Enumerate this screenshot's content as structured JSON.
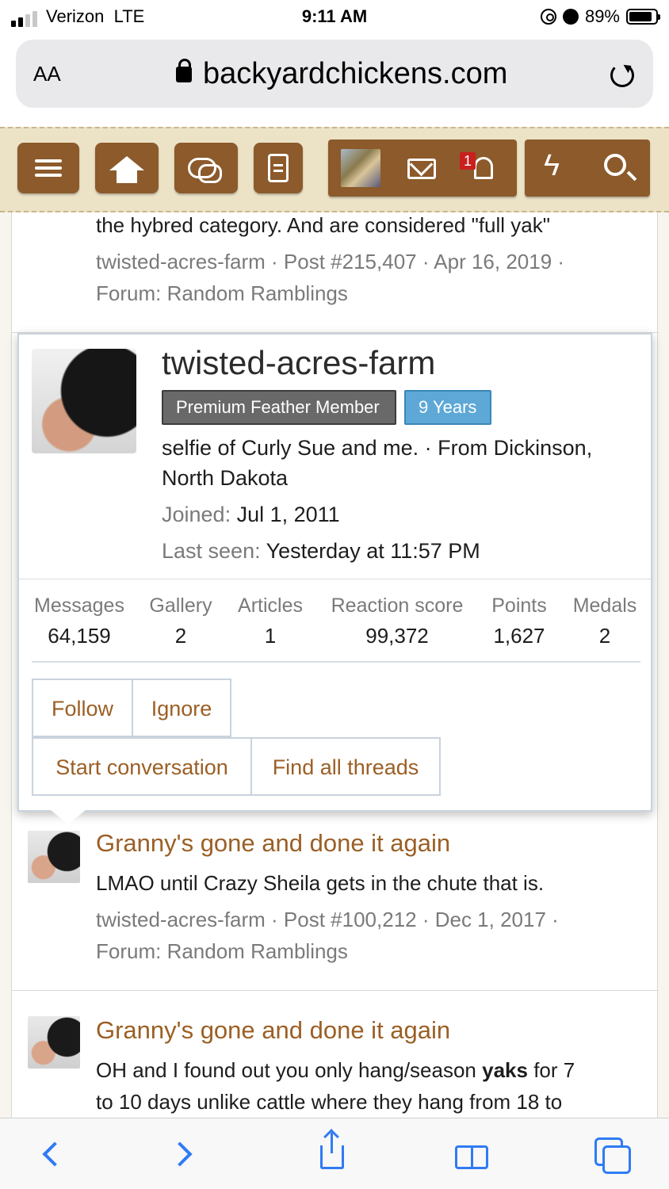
{
  "status_bar": {
    "carrier": "Verizon",
    "network": "LTE",
    "time": "9:11 AM",
    "battery_percent": "89%",
    "battery_level": 0.89,
    "icons": [
      "signal-bars-icon",
      "orientation-lock-icon",
      "alarm-icon",
      "battery-icon"
    ]
  },
  "browser": {
    "text_size_label": "AA",
    "host": "backyardchickens.com",
    "icons": [
      "lock-icon",
      "reload-icon"
    ]
  },
  "site_nav": {
    "notification_count": "1",
    "icons": [
      "menu-icon",
      "home-icon",
      "forums-icon",
      "articles-icon",
      "avatar-thumbnail",
      "inbox-icon",
      "bell-icon",
      "whats-new-icon",
      "search-icon"
    ],
    "brand_color": "#8c5a2b"
  },
  "results": [
    {
      "text": "the hybred category. And are considered \"full yak\"",
      "meta_line1": "twisted-acres-farm · Post #215,407 · Apr 16, 2019 ·",
      "meta_line2": "Forum: Random Ramblings"
    },
    {
      "title": "Granny's gone and done it again",
      "text": "LMAO until Crazy Sheila gets in the chute that is.",
      "meta_line1": "twisted-acres-farm · Post #100,212 · Dec 1, 2017 ·",
      "meta_line2": "Forum: Random Ramblings"
    },
    {
      "title": "Granny's gone and done it again",
      "text_before": "OH and I found out you only hang/season ",
      "text_bold": "yaks",
      "text_after": " for 7",
      "text_line2": "to 10 days unlike cattle where they hang from 18 to"
    }
  ],
  "member_card": {
    "username": "twisted-acres-farm",
    "rank": "Premium Feather Member",
    "tenure": "9 Years",
    "about_line1": "selfie of Curly Sue and me. · From Dickinson,",
    "about_line2": "North Dakota",
    "joined_label": "Joined:",
    "joined_value": "Jul 1, 2011",
    "seen_label": "Last seen:",
    "seen_value": "Yesterday at 11:57 PM",
    "stats": [
      {
        "label": "Messages",
        "value": "64,159"
      },
      {
        "label": "Gallery",
        "value": "2"
      },
      {
        "label": "Articles",
        "value": "1"
      },
      {
        "label": "Reaction score",
        "value": "99,372"
      },
      {
        "label": "Points",
        "value": "1,627"
      },
      {
        "label": "Medals",
        "value": "2"
      }
    ],
    "actions": {
      "follow": "Follow",
      "ignore": "Ignore",
      "start_conversation": "Start conversation",
      "find_threads": "Find all threads"
    },
    "link_color": "#9b5f25"
  },
  "toolbar": {
    "icons": [
      "back-icon",
      "forward-icon",
      "share-icon",
      "bookmarks-icon",
      "tabs-icon"
    ],
    "accent": "#2f7bf5"
  }
}
